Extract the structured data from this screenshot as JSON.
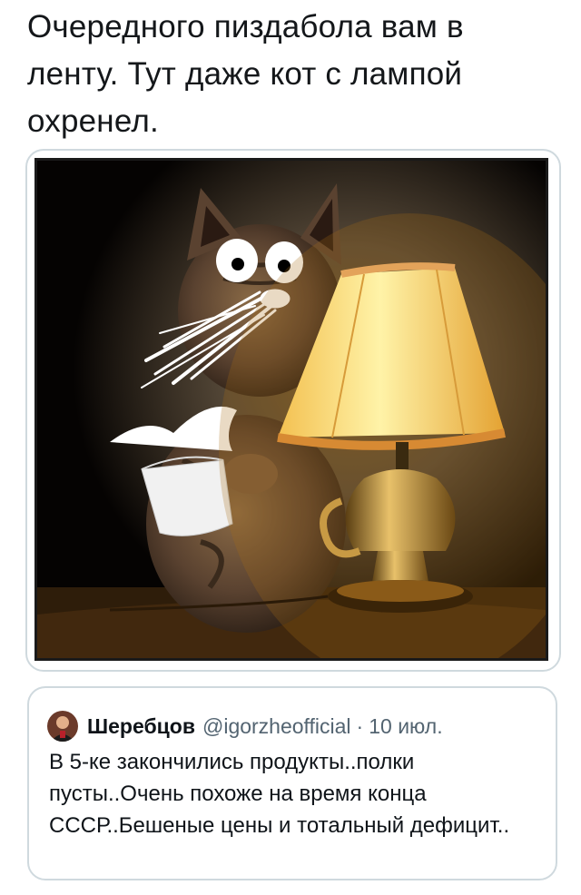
{
  "tweet": {
    "text": "Очередного пиздабола вам в ленту. Тут даже кот с лампой охренел."
  },
  "media": {
    "subject": "cat-with-lamp-and-milk-cup"
  },
  "quote": {
    "author_name": "Шеребцов",
    "author_handle": "@igorzheofficial",
    "separator": "·",
    "date": "10 июл.",
    "text": "В 5-ке закончились продукты..полки пусты..Очень похоже на время конца СССР..Бешеные цены и тотальный дефицит.."
  },
  "colors": {
    "border": "#cfd9de",
    "secondary_text": "#536471",
    "primary_text": "#0f1419"
  }
}
